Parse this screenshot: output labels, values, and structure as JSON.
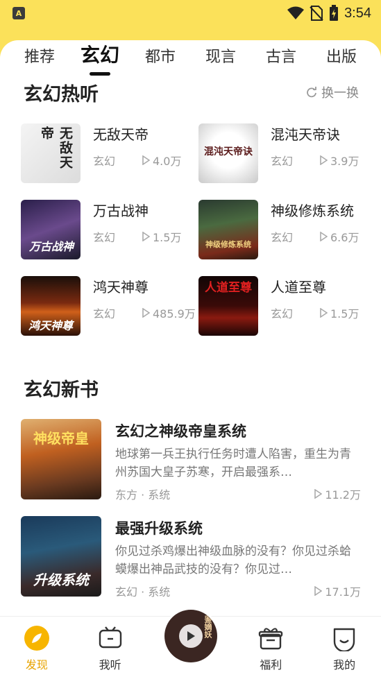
{
  "status_bar": {
    "time": "3:54",
    "app_icon": "A"
  },
  "tabs": [
    {
      "label": "推荐",
      "active": false
    },
    {
      "label": "玄幻",
      "active": true
    },
    {
      "label": "都市",
      "active": false
    },
    {
      "label": "现言",
      "active": false
    },
    {
      "label": "古言",
      "active": false
    },
    {
      "label": "出版",
      "active": false
    }
  ],
  "hot_section": {
    "title": "玄幻热听",
    "refresh_label": "换一换",
    "items": [
      {
        "title": "无敌天帝",
        "genre": "玄幻",
        "plays": "4.0万",
        "cover_text": "无敌天帝"
      },
      {
        "title": "混沌天帝诀",
        "genre": "玄幻",
        "plays": "3.9万",
        "cover_text": "混沌天帝诀"
      },
      {
        "title": "万古战神",
        "genre": "玄幻",
        "plays": "1.5万",
        "cover_text": "万古战神"
      },
      {
        "title": "神级修炼系统",
        "genre": "玄幻",
        "plays": "6.6万",
        "cover_text": "神级修炼系统"
      },
      {
        "title": "鸿天神尊",
        "genre": "玄幻",
        "plays": "485.9万",
        "cover_text": "鸿天神尊"
      },
      {
        "title": "人道至尊",
        "genre": "玄幻",
        "plays": "1.5万",
        "cover_text": "人道至尊"
      }
    ]
  },
  "new_section": {
    "title": "玄幻新书",
    "items": [
      {
        "title": "玄幻之神级帝皇系统",
        "desc": "地球第一兵王执行任务时遭人陷害，重生为青州苏国大皇子苏寒，开启最强系…",
        "tags": "东方 · 系统",
        "plays": "11.2万",
        "cover_text": "神级帝皇"
      },
      {
        "title": "最强升级系统",
        "desc": "你见过杀鸡爆出神级血脉的没有？你见过杀蛤蟆爆出神品武技的没有？你见过…",
        "tags": "玄幻 · 系统",
        "plays": "17.1万",
        "cover_text": "升级系统"
      }
    ]
  },
  "bottom_nav": [
    {
      "label": "发现",
      "icon": "compass-icon",
      "active": true
    },
    {
      "label": "我听",
      "icon": "tv-icon",
      "active": false
    },
    {
      "label": "福利",
      "icon": "gift-icon",
      "active": false
    },
    {
      "label": "我的",
      "icon": "smile-icon",
      "active": false
    }
  ],
  "player": {
    "cover_text": "鉴嫡妖"
  },
  "colors": {
    "brand_yellow": "#fbe15a",
    "active_orange": "#e7a300"
  }
}
